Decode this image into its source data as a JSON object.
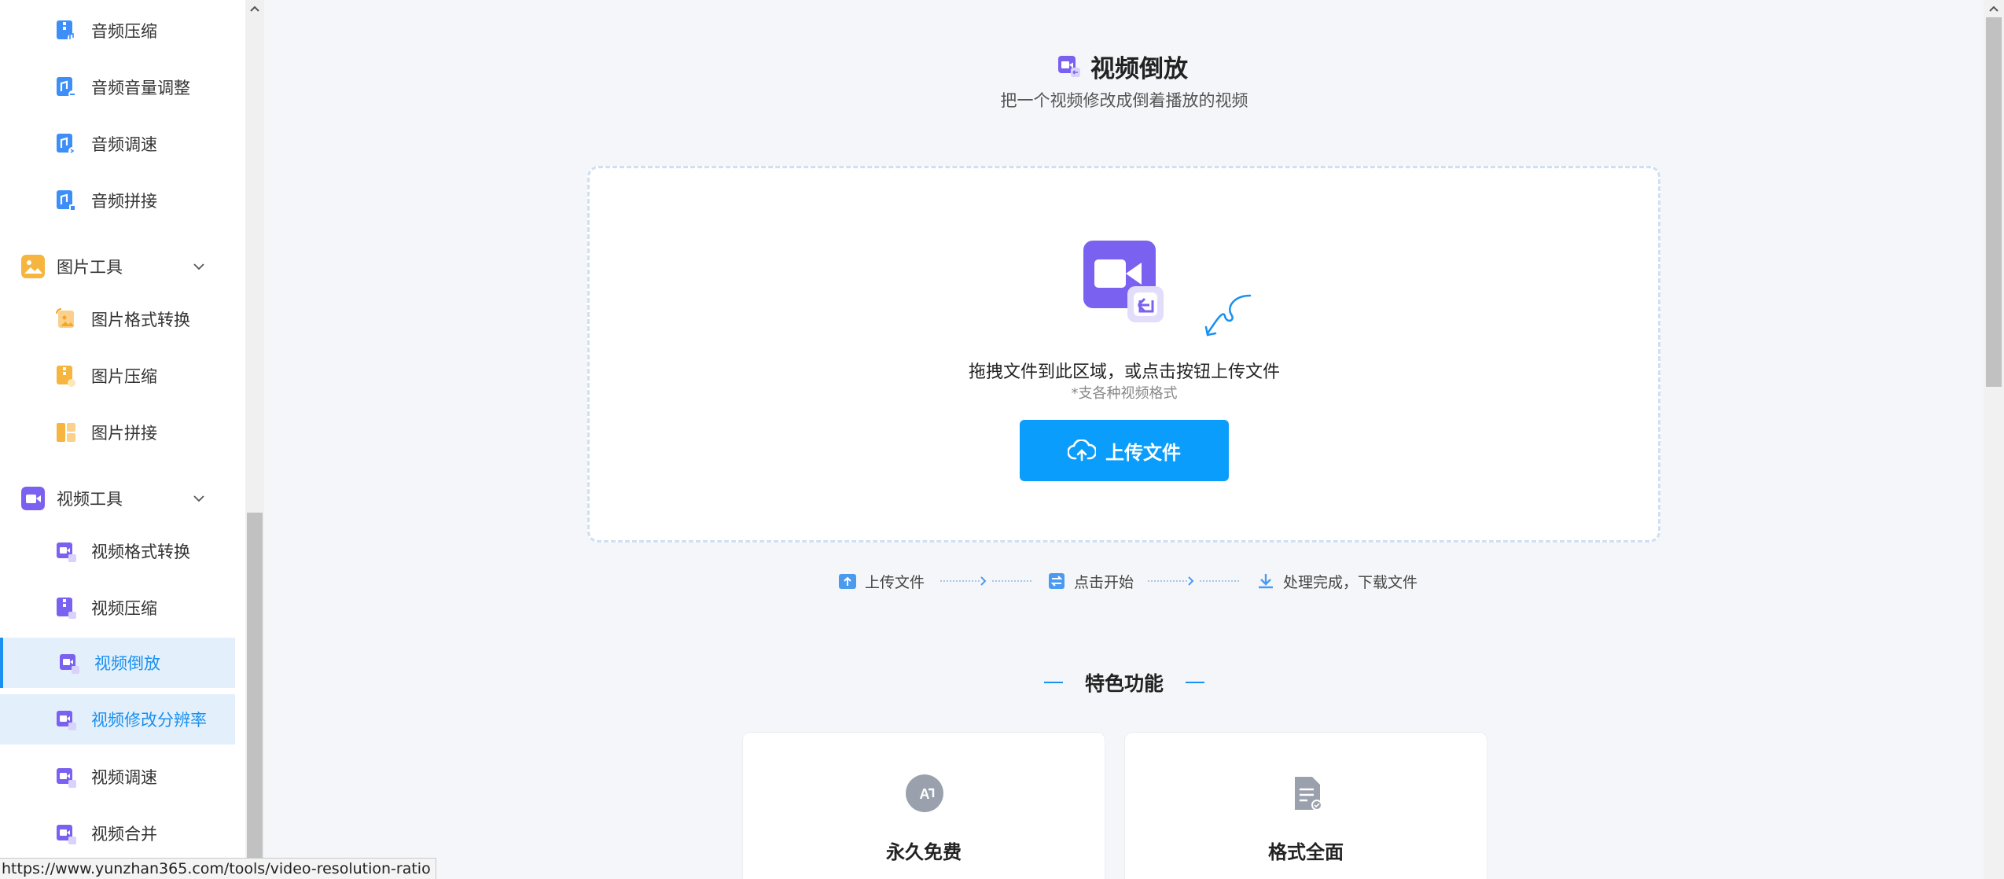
{
  "sidebar": {
    "audio_items": [
      {
        "label": "音频压缩",
        "icon": "audio-compress-icon"
      },
      {
        "label": "音频音量调整",
        "icon": "audio-volume-icon"
      },
      {
        "label": "音频调速",
        "icon": "audio-speed-icon"
      },
      {
        "label": "音频拼接",
        "icon": "audio-join-icon"
      }
    ],
    "image_group": {
      "label": "图片工具",
      "icon": "image-tools-icon"
    },
    "image_items": [
      {
        "label": "图片格式转换",
        "icon": "image-convert-icon"
      },
      {
        "label": "图片压缩",
        "icon": "image-compress-icon"
      },
      {
        "label": "图片拼接",
        "icon": "image-join-icon"
      }
    ],
    "video_group": {
      "label": "视频工具",
      "icon": "video-tools-icon"
    },
    "video_items": [
      {
        "label": "视频格式转换",
        "icon": "video-convert-icon"
      },
      {
        "label": "视频压缩",
        "icon": "video-compress-icon"
      },
      {
        "label": "视频倒放",
        "icon": "video-reverse-icon",
        "state": "active"
      },
      {
        "label": "视频修改分辨率",
        "icon": "video-resolution-icon",
        "state": "hover"
      },
      {
        "label": "视频调速",
        "icon": "video-speed-icon"
      },
      {
        "label": "视频合并",
        "icon": "video-merge-icon"
      }
    ]
  },
  "main": {
    "title": "视频倒放",
    "subtitle": "把一个视频修改成倒着播放的视频",
    "drop_text": "拖拽文件到此区域，或点击按钮上传文件",
    "drop_hint": "*支各种视频格式",
    "upload_button": "上传文件",
    "steps": [
      {
        "label": "上传文件",
        "icon": "upload-step-icon"
      },
      {
        "label": "点击开始",
        "icon": "start-step-icon"
      },
      {
        "label": "处理完成，下载文件",
        "icon": "download-step-icon"
      }
    ],
    "features_title": "特色功能",
    "features": [
      {
        "label": "永久免费",
        "icon": "free-icon"
      },
      {
        "label": "格式全面",
        "icon": "formats-icon"
      }
    ]
  },
  "status_bar": {
    "url": "https://www.yunzhan365.com/tools/video-resolution-ratio"
  },
  "colors": {
    "accent": "#0a9dfb",
    "active_bg": "#e3f0fc",
    "active_text": "#1a90f0",
    "video_purple": "#7b61f0",
    "image_orange": "#f5b53f",
    "audio_blue": "#3e8ef7"
  }
}
